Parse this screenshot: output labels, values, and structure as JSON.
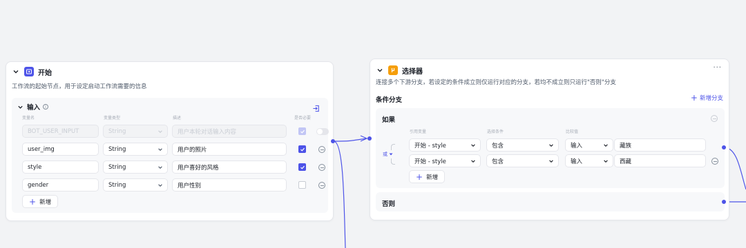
{
  "start_node": {
    "title": "开始",
    "description": "工作流的起始节点，用于设定启动工作流需要的信息",
    "input_section": {
      "title": "输入",
      "columns": [
        "变量名",
        "变量类型",
        "描述",
        "是否必要"
      ],
      "rows": [
        {
          "name": "BOT_USER_INPUT",
          "type": "String",
          "description": "",
          "description_placeholder": "用户本轮对话输入内容",
          "required": true,
          "disabled": true
        },
        {
          "name": "user_img",
          "type": "String",
          "description": "用户的照片",
          "required": true,
          "disabled": false
        },
        {
          "name": "style",
          "type": "String",
          "description": "用户喜好的风格",
          "required": true,
          "disabled": false
        },
        {
          "name": "gender",
          "type": "String",
          "description": "用户性别",
          "required": false,
          "disabled": false
        }
      ],
      "add_label": "新增"
    }
  },
  "selector_node": {
    "title": "选择器",
    "description": "连接多个下游分支，若设定的条件成立则仅运行对应的分支，若均不成立则只运行\"否则\"分支",
    "branches_title": "条件分支",
    "add_branch_label": "新增分支",
    "if_label": "如果",
    "logic_label": "或",
    "columns": [
      "引用变量",
      "选择条件",
      "比较值"
    ],
    "conditions": [
      {
        "ref": "开始 - style",
        "op": "包含",
        "value_type": "输入",
        "value": "藏族"
      },
      {
        "ref": "开始 - style",
        "op": "包含",
        "value_type": "输入",
        "value": "西藏"
      }
    ],
    "add_label": "新增",
    "else_label": "否则"
  },
  "colors": {
    "accent": "#4d53e8",
    "start_icon": "#4d53e8",
    "selector_icon": "#f59e0b"
  }
}
